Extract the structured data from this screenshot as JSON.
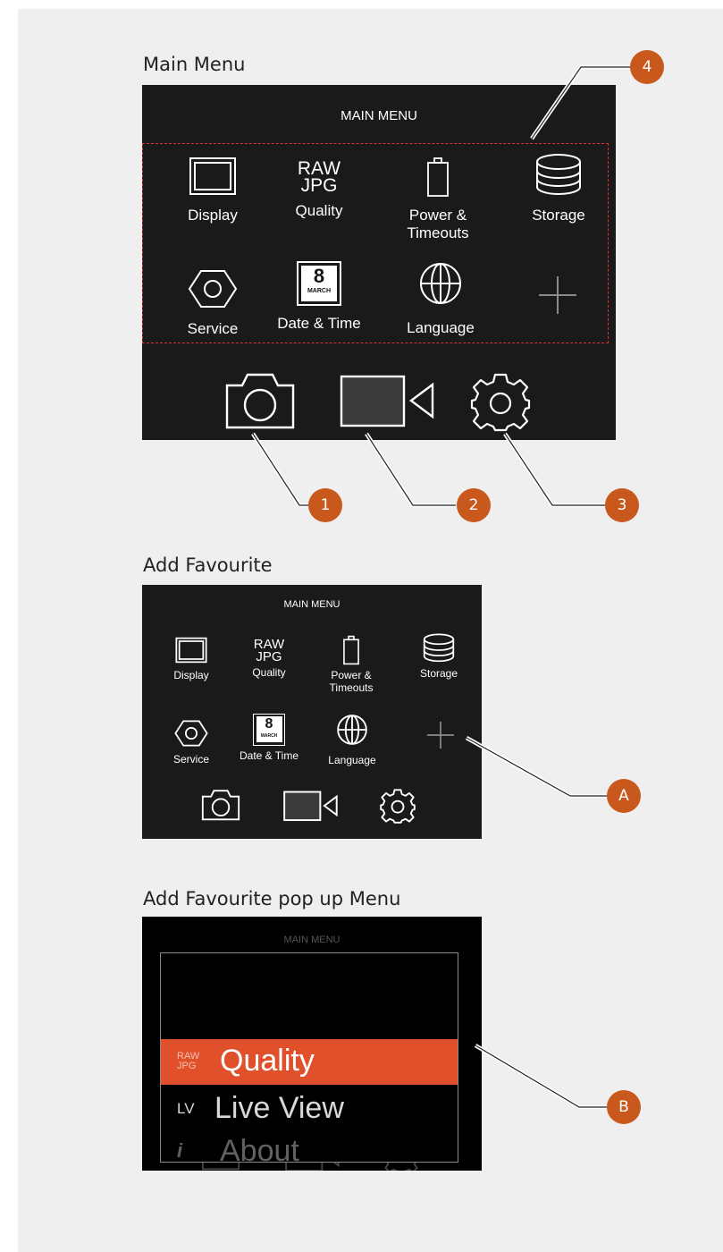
{
  "sections": {
    "main": "Main Menu",
    "add": "Add Favourite",
    "popup": "Add Favourite pop up Menu"
  },
  "screen_title": "MAIN MENU",
  "menu_items": [
    {
      "label": "Display",
      "icon": "display-icon"
    },
    {
      "label": "Quality",
      "icon": "raw-jpg-icon",
      "icon_text_1": "RAW",
      "icon_text_2": "JPG"
    },
    {
      "label": "Power &\nTimeouts",
      "icon": "battery-icon"
    },
    {
      "label": "Storage",
      "icon": "storage-icon"
    },
    {
      "label": "Service",
      "icon": "hexagon-nut-icon"
    },
    {
      "label": "Date & Time",
      "icon": "calendar-icon",
      "icon_text_1": "8",
      "icon_text_2": "MARCH"
    },
    {
      "label": "Language",
      "icon": "globe-icon"
    },
    {
      "label": "",
      "icon": "plus-icon"
    }
  ],
  "bottom_icons": [
    "camera-icon",
    "video-icon",
    "settings-gear-icon"
  ],
  "callouts": {
    "c1": "1",
    "c2": "2",
    "c3": "3",
    "c4": "4",
    "cA": "A",
    "cB": "B"
  },
  "popup_items": [
    {
      "prefix_1": "RAW",
      "prefix_2": "JPG",
      "label": "Quality",
      "selected": true
    },
    {
      "prefix_1": "LV",
      "label": "Live View",
      "selected": false
    },
    {
      "prefix_1": "i",
      "label": "About",
      "selected": false
    }
  ],
  "colors": {
    "accent": "#e0502a",
    "callout": "#c8581c",
    "screen_bg": "#1a1a1a",
    "highlight_border": "#e0303a"
  }
}
